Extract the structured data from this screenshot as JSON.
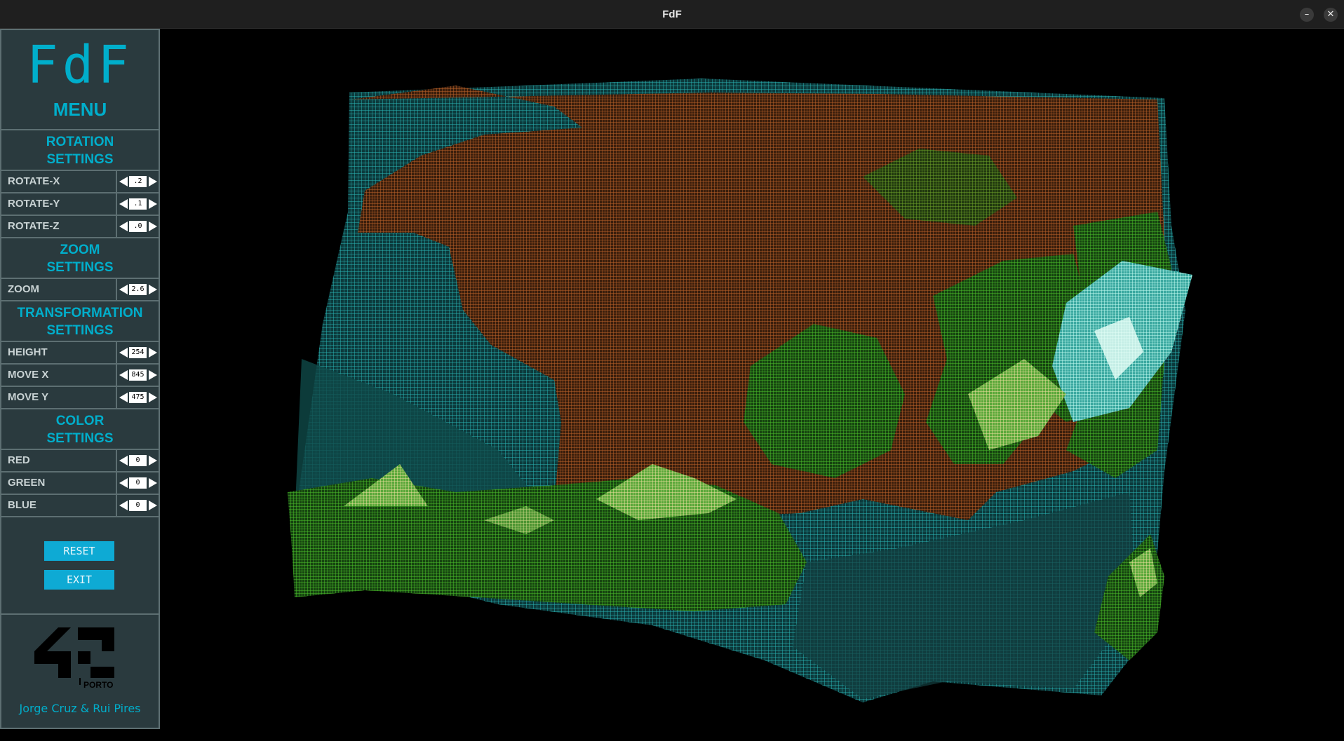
{
  "window": {
    "title": "FdF",
    "minimize_icon": "minimize-icon",
    "close_icon": "close-icon"
  },
  "menu": {
    "logo": "FdF",
    "title": "MENU",
    "sections": {
      "rotation": [
        "ROTATION",
        "SETTINGS"
      ],
      "zoom": [
        "ZOOM",
        "SETTINGS"
      ],
      "transformation": [
        "TRANSFORMATION",
        "SETTINGS"
      ],
      "color": [
        "COLOR",
        "SETTINGS"
      ]
    },
    "controls": {
      "rotate_x": {
        "label": "ROTATE-X",
        "value": ".2"
      },
      "rotate_y": {
        "label": "ROTATE-Y",
        "value": ".1"
      },
      "rotate_z": {
        "label": "ROTATE-Z",
        "value": ".0"
      },
      "zoom": {
        "label": "ZOOM",
        "value": "2.6"
      },
      "height": {
        "label": "HEIGHT",
        "value": "254"
      },
      "move_x": {
        "label": "MOVE X",
        "value": "845"
      },
      "move_y": {
        "label": "MOVE Y",
        "value": "475"
      },
      "red": {
        "label": "RED",
        "value": "0"
      },
      "green": {
        "label": "GREEN",
        "value": "0"
      },
      "blue": {
        "label": "BLUE",
        "value": "0"
      }
    },
    "buttons": {
      "reset": "RESET",
      "exit": "EXIT"
    },
    "footer": {
      "school": "42",
      "campus": "PORTO",
      "authors": "Jorge Cruz & Rui Pires"
    }
  },
  "colors": {
    "accent": "#00aecb",
    "panel_bg": "#2a3a3e",
    "panel_border": "#5d6f72",
    "button_bg": "#0eaad4",
    "land_low": "#c0642a",
    "land_mid": "#4cc02a",
    "land_high": "#f2e0a0",
    "sea": "#2ab4b4"
  }
}
